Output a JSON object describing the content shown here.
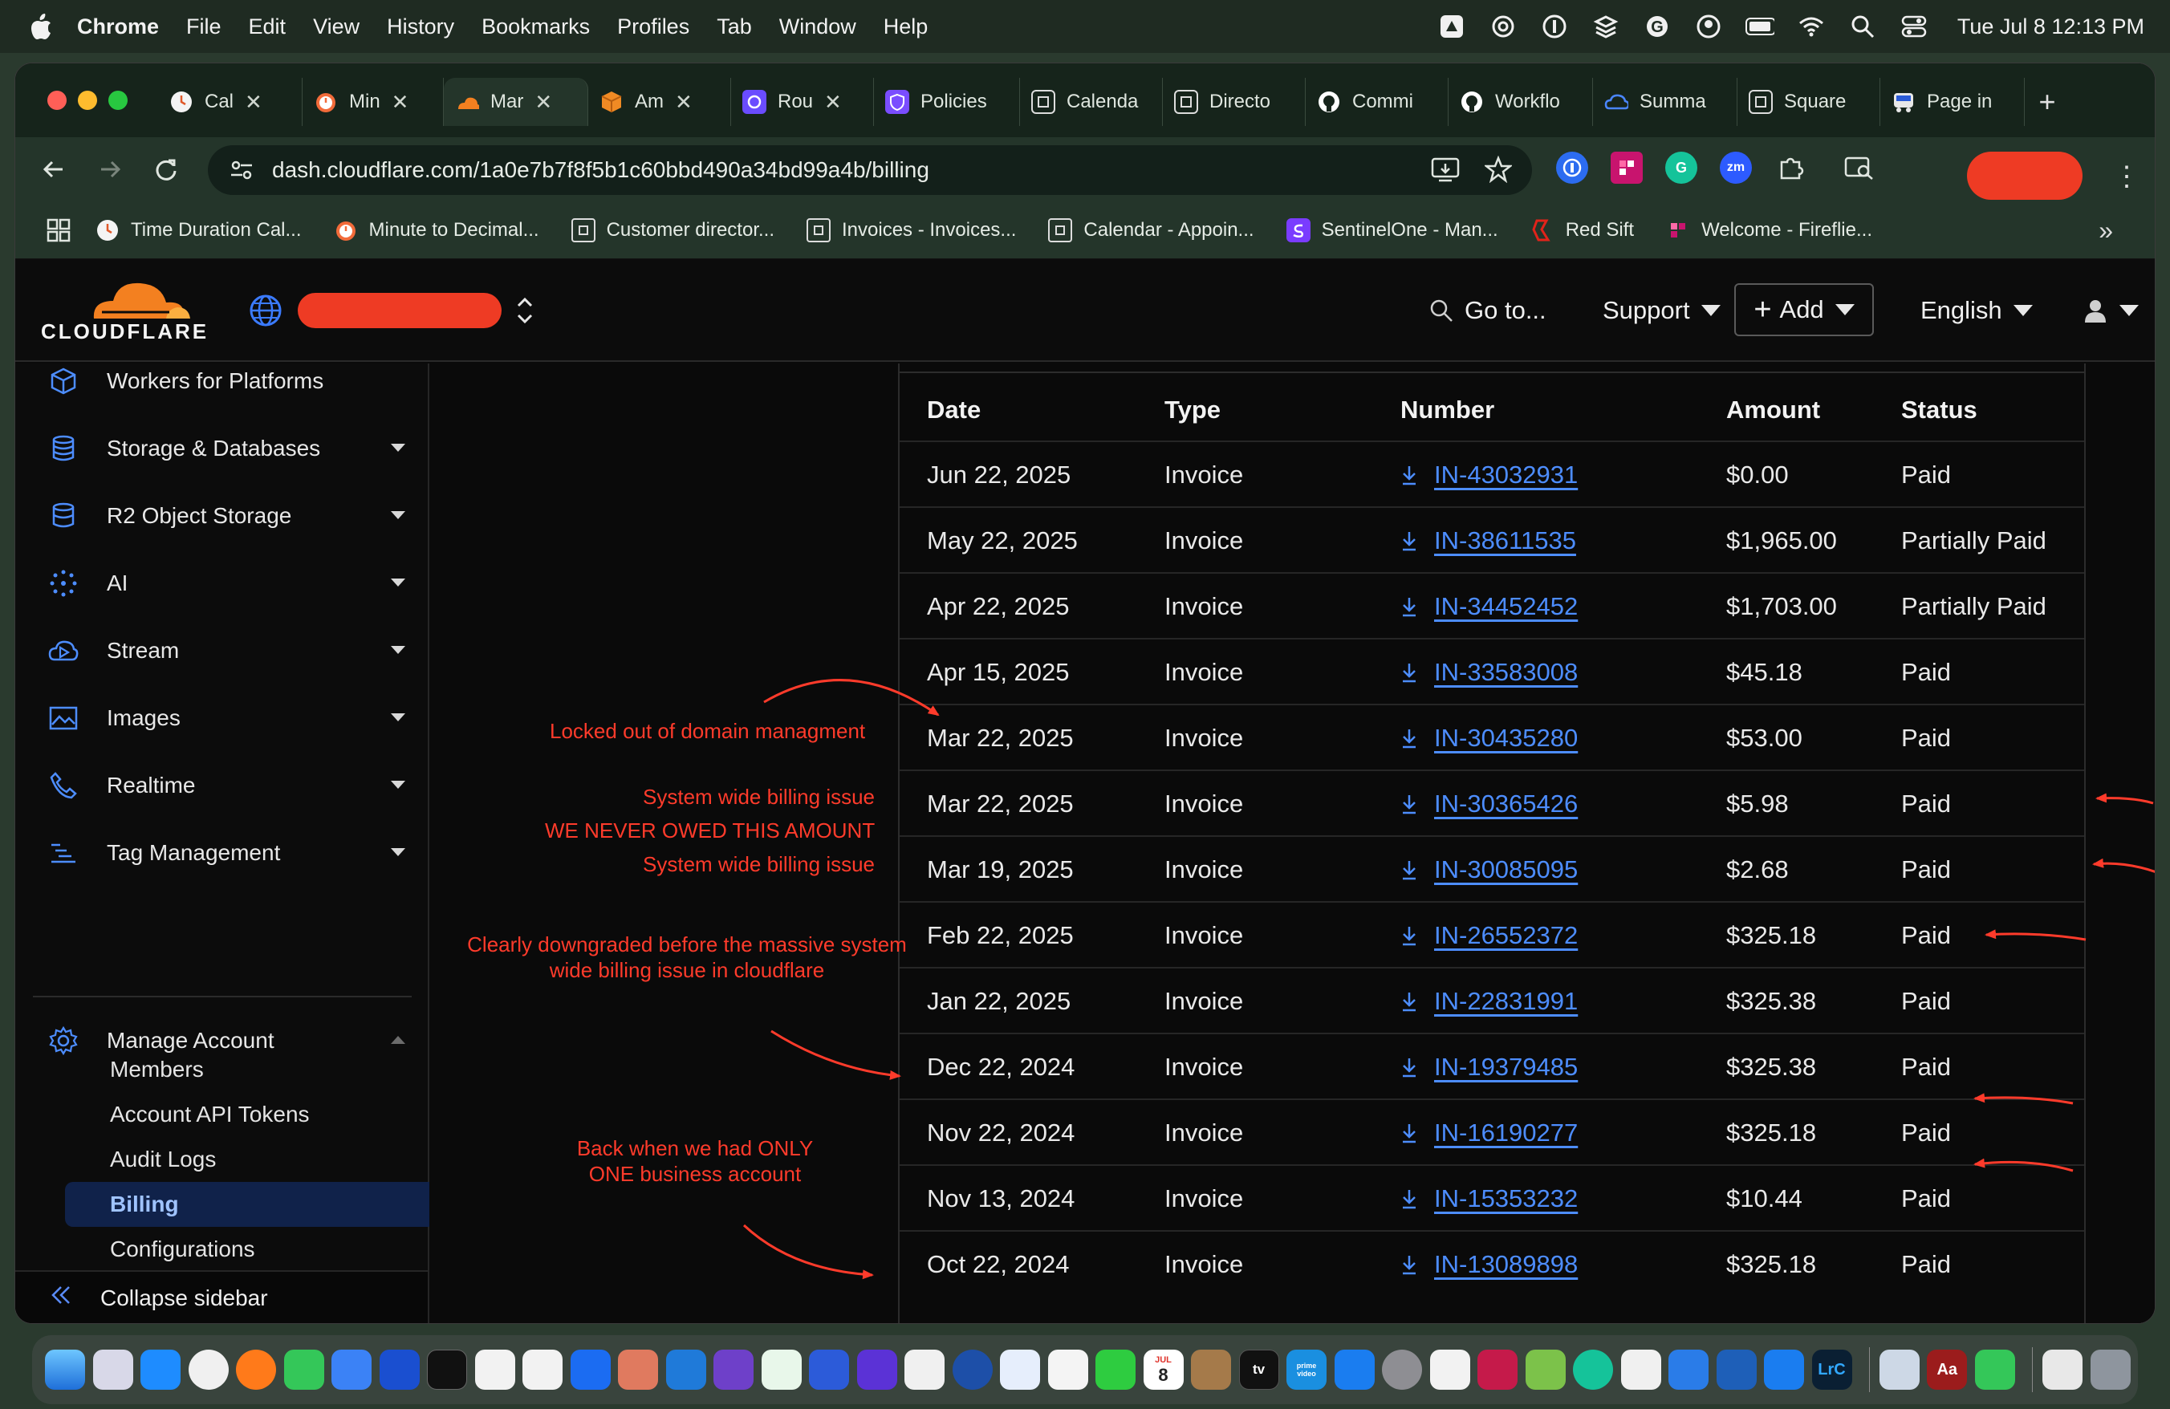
{
  "menubar": {
    "app_name": "Chrome",
    "items": [
      "File",
      "Edit",
      "View",
      "History",
      "Bookmarks",
      "Profiles",
      "Tab",
      "Window",
      "Help"
    ],
    "clock": "Tue Jul 8  12:13 PM"
  },
  "tabs": [
    {
      "label": "Cal",
      "color": "#f4f4f4",
      "closable": true
    },
    {
      "label": "Min",
      "color": "#f26b3a",
      "closable": true
    },
    {
      "label": "Mar",
      "color": "#f38020",
      "closable": true,
      "active": true
    },
    {
      "label": "Am",
      "color": "#f08a24",
      "closable": true
    },
    {
      "label": "Rou",
      "color": "#6a4cff",
      "closable": true
    },
    {
      "label": "Policies",
      "color": "#7a4dff",
      "closable": false
    },
    {
      "label": "Calenda",
      "color": "#1a1a1a",
      "closable": false
    },
    {
      "label": "Directo",
      "color": "#1a1a1a",
      "closable": false
    },
    {
      "label": "Commi",
      "color": "#ffffff",
      "closable": false
    },
    {
      "label": "Workflo",
      "color": "#ffffff",
      "closable": false
    },
    {
      "label": "Summa",
      "color": "#2a6cff",
      "closable": false
    },
    {
      "label": "Square",
      "color": "#1a1a1a",
      "closable": false
    },
    {
      "label": "Page in",
      "color": "#e8e8e8",
      "closable": false
    }
  ],
  "omnibox": {
    "url": "dash.cloudflare.com/1a0e7b7f8f5b1c60bbd490a34bd99a4b/billing"
  },
  "bookmarks": [
    {
      "label": "Time Duration Cal...",
      "color": "#f4f4f4"
    },
    {
      "label": "Minute to Decimal...",
      "color": "#f26b3a"
    },
    {
      "label": "Customer director...",
      "color": "#1a1a1a"
    },
    {
      "label": "Invoices - Invoices...",
      "color": "#1a1a1a"
    },
    {
      "label": "Calendar - Appoin...",
      "color": "#1a1a1a"
    },
    {
      "label": "SentinelOne - Man...",
      "color": "#7a3cff"
    },
    {
      "label": "Red Sift",
      "color": "#e2231a"
    },
    {
      "label": "Welcome - Fireflie...",
      "color": "#c8146e"
    }
  ],
  "header": {
    "logo_text": "CLOUDFLARE",
    "goto_label": "Go to...",
    "support_label": "Support",
    "add_label": "Add",
    "language_label": "English"
  },
  "sidebar": {
    "items": [
      {
        "label": "Workers for Platforms",
        "icon": "cube-icon",
        "expandable": false
      },
      {
        "label": "Storage & Databases",
        "icon": "database-icon",
        "expandable": true
      },
      {
        "label": "R2 Object Storage",
        "icon": "bucket-icon",
        "expandable": true
      },
      {
        "label": "AI",
        "icon": "sparkle-icon",
        "expandable": true
      },
      {
        "label": "Stream",
        "icon": "cloud-play-icon",
        "expandable": true
      },
      {
        "label": "Images",
        "icon": "image-icon",
        "expandable": true
      },
      {
        "label": "Realtime",
        "icon": "phone-icon",
        "expandable": true
      },
      {
        "label": "Tag Management",
        "icon": "list-icon",
        "expandable": true
      }
    ],
    "manage_account": {
      "label": "Manage Account",
      "sub_items": [
        "Members",
        "Account API Tokens",
        "Audit Logs",
        "Billing",
        "Configurations"
      ],
      "active": "Billing"
    },
    "collapse_label": "Collapse sidebar"
  },
  "invoices": {
    "columns": [
      "Date",
      "Type",
      "Number",
      "Amount",
      "Status"
    ],
    "rows": [
      {
        "date": "Jun 22, 2025",
        "type": "Invoice",
        "number": "IN-43032931",
        "amount": "$0.00",
        "status": "Paid"
      },
      {
        "date": "May 22, 2025",
        "type": "Invoice",
        "number": "IN-38611535",
        "amount": "$1,965.00",
        "status": "Partially Paid"
      },
      {
        "date": "Apr 22, 2025",
        "type": "Invoice",
        "number": "IN-34452452",
        "amount": "$1,703.00",
        "status": "Partially Paid"
      },
      {
        "date": "Apr 15, 2025",
        "type": "Invoice",
        "number": "IN-33583008",
        "amount": "$45.18",
        "status": "Paid"
      },
      {
        "date": "Mar 22, 2025",
        "type": "Invoice",
        "number": "IN-30435280",
        "amount": "$53.00",
        "status": "Paid"
      },
      {
        "date": "Mar 22, 2025",
        "type": "Invoice",
        "number": "IN-30365426",
        "amount": "$5.98",
        "status": "Paid"
      },
      {
        "date": "Mar 19, 2025",
        "type": "Invoice",
        "number": "IN-30085095",
        "amount": "$2.68",
        "status": "Paid"
      },
      {
        "date": "Feb 22, 2025",
        "type": "Invoice",
        "number": "IN-26552372",
        "amount": "$325.18",
        "status": "Paid"
      },
      {
        "date": "Jan 22, 2025",
        "type": "Invoice",
        "number": "IN-22831991",
        "amount": "$325.38",
        "status": "Paid"
      },
      {
        "date": "Dec 22, 2024",
        "type": "Invoice",
        "number": "IN-19379485",
        "amount": "$325.38",
        "status": "Paid"
      },
      {
        "date": "Nov 22, 2024",
        "type": "Invoice",
        "number": "IN-16190277",
        "amount": "$325.18",
        "status": "Paid"
      },
      {
        "date": "Nov 13, 2024",
        "type": "Invoice",
        "number": "IN-15353232",
        "amount": "$10.44",
        "status": "Paid"
      },
      {
        "date": "Oct 22, 2024",
        "type": "Invoice",
        "number": "IN-13089898",
        "amount": "$325.18",
        "status": "Paid"
      }
    ]
  },
  "annotations": {
    "locked_out": "Locked out of domain  managment",
    "billing_issue_1": "System wide billing  issue",
    "never_owed": "WE NEVER OWED THIS AMOUNT",
    "billing_issue_2": "System wide billing  issue",
    "downgraded_line1": "Clearly downgraded before the massive system",
    "downgraded_line2": "wide billing issue in cloudflare",
    "one_account_line1": "Back when we had ONLY",
    "one_account_line2": "ONE business account",
    "color": "#ff3b2b"
  },
  "dock": {
    "calendar_month": "JUL",
    "calendar_day": "8",
    "tv_label": "tv",
    "prime_label": "prime video",
    "lrc_label": "LrC",
    "aa_label": "Aa"
  }
}
